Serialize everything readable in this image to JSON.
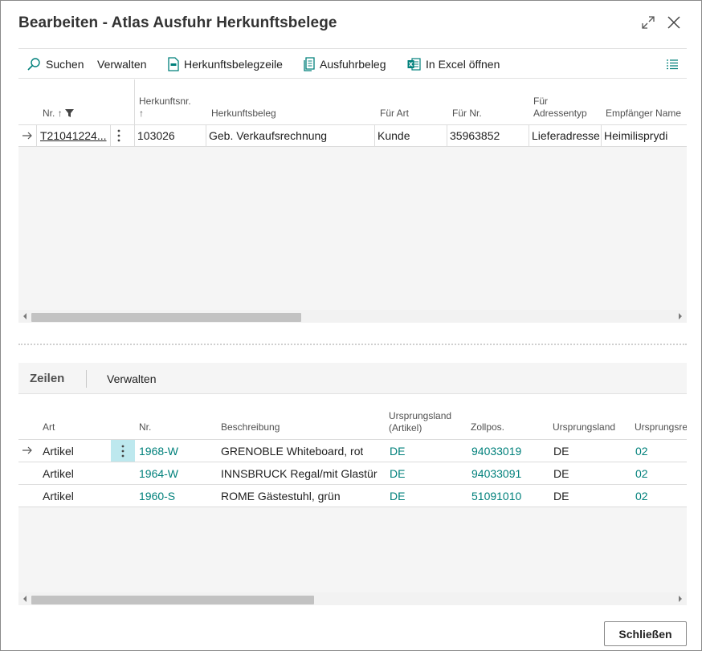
{
  "dialog": {
    "title": "Bearbeiten - Atlas Ausfuhr Herkunftsbelege",
    "expand_icon": "expand-icon",
    "close_icon": "close-icon"
  },
  "toolbar": {
    "search_label": "Suchen",
    "manage_label": "Verwalten",
    "source_line_label": "Herkunftsbelegzeile",
    "export_doc_label": "Ausfuhrbeleg",
    "excel_label": "In Excel öffnen"
  },
  "header_table": {
    "columns": {
      "nr": "Nr.",
      "herkunftsnr_1": "Herkunftsnr.",
      "herkunftsnr_arrow": "↑",
      "herkunftsbeleg": "Herkunftsbeleg",
      "fuer_art": "Für Art",
      "fuer_nr": "Für Nr.",
      "adressentyp_1": "Für",
      "adressentyp_2": "Adressentyp",
      "empfaenger": "Empfänger Name"
    },
    "rows": [
      {
        "nr": "T21041224...",
        "herkunftsnr": "103026",
        "herkunftsbeleg": "Geb. Verkaufsrechnung",
        "fuer_art": "Kunde",
        "fuer_nr": "35963852",
        "adressentyp": "Lieferadresse",
        "empfaenger": "Heimilisprydi"
      }
    ]
  },
  "lines": {
    "tab_label": "Zeilen",
    "manage_label": "Verwalten",
    "columns": {
      "art": "Art",
      "nr": "Nr.",
      "beschreibung": "Beschreibung",
      "ursprungsland_artikel_1": "Ursprungsland",
      "ursprungsland_artikel_2": "(Artikel)",
      "zollpos": "Zollpos.",
      "ursprungsland": "Ursprungsland",
      "ursprungsregion": "Ursprungsre"
    },
    "rows": [
      {
        "art": "Artikel",
        "nr": "1968-W",
        "beschreibung": "GRENOBLE Whiteboard, rot",
        "ursprungsland_artikel": "DE",
        "zollpos": "94033019",
        "ursprungsland": "DE",
        "ursprungsregion": "02"
      },
      {
        "art": "Artikel",
        "nr": "1964-W",
        "beschreibung": "INNSBRUCK Regal/mit Glastür",
        "ursprungsland_artikel": "DE",
        "zollpos": "94033091",
        "ursprungsland": "DE",
        "ursprungsregion": "02"
      },
      {
        "art": "Artikel",
        "nr": "1960-S",
        "beschreibung": "ROME Gästestuhl, grün",
        "ursprungsland_artikel": "DE",
        "zollpos": "51091010",
        "ursprungsland": "DE",
        "ursprungsregion": "02"
      }
    ]
  },
  "footer": {
    "close_label": "Schließen"
  },
  "colors": {
    "link": "#00807b",
    "selected_cell": "#bde8ee"
  }
}
